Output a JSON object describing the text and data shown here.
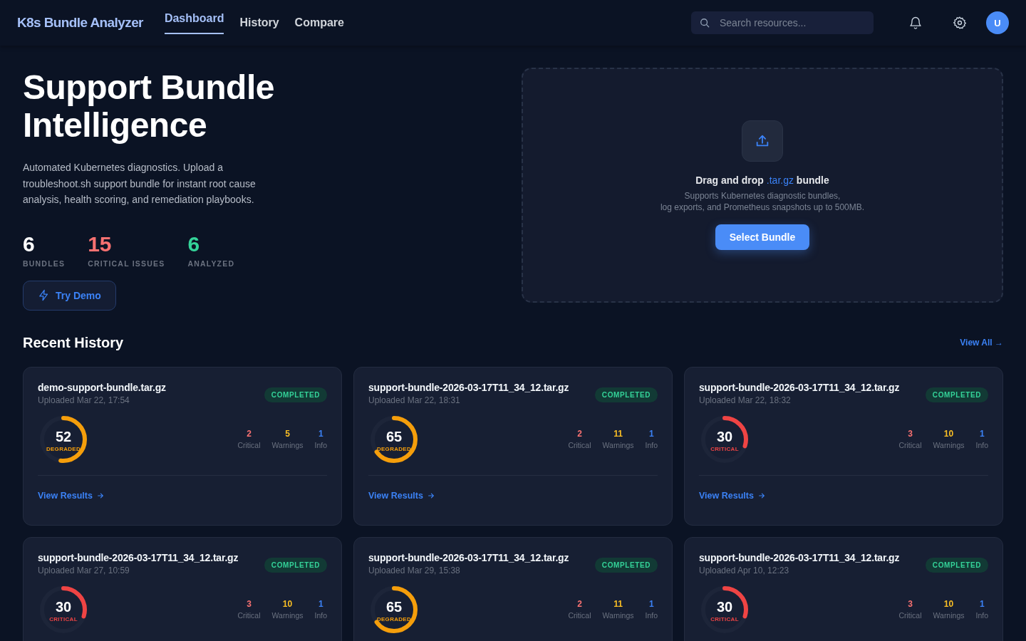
{
  "header": {
    "logo": "K8s Bundle Analyzer",
    "nav": [
      {
        "label": "Dashboard",
        "selected": true
      },
      {
        "label": "History",
        "selected": false
      },
      {
        "label": "Compare",
        "selected": false
      }
    ],
    "search": {
      "placeholder": "Search resources..."
    },
    "avatar": "U"
  },
  "hero": {
    "title": "Support Bundle Intelligence",
    "description": "Automated Kubernetes diagnostics. Upload a troubleshoot.sh support bundle for instant root cause analysis, health scoring, and remediation playbooks.",
    "stats": [
      {
        "value": "6",
        "label": "BUNDLES",
        "color": "#ffffff"
      },
      {
        "value": "15",
        "label": "CRITICAL ISSUES",
        "color": "#f87171"
      },
      {
        "value": "6",
        "label": "ANALYZED",
        "color": "#34d399"
      }
    ],
    "demo_button": "Try Demo"
  },
  "upload": {
    "heading": "Drag and drop *.tar.gz* bundle",
    "hint_lines": [
      "Supports Kubernetes diagnostic bundles,",
      "log exports, and Prometheus snapshots up to 500MB."
    ],
    "button": "Select Bundle"
  },
  "history": {
    "title": "Recent History",
    "view_all": "View All →",
    "cards": [
      {
        "name": "demo-support-bundle.tar.gz",
        "uploaded": "Uploaded Mar 22, 17:54",
        "status": "COMPLETED",
        "score": "52",
        "level": 0.52,
        "health": "DEGRADED",
        "kind": "degraded",
        "counts": [
          {
            "value": "2",
            "label": "Critical",
            "kind": "critical"
          },
          {
            "value": "5",
            "label": "Warnings",
            "kind": "warning"
          },
          {
            "value": "1",
            "label": "Info",
            "kind": "info"
          }
        ],
        "link": "View Results"
      },
      {
        "name": "support-bundle-2026-03-17T11_34_12.tar.gz",
        "uploaded": "Uploaded Mar 22, 18:31",
        "status": "COMPLETED",
        "score": "65",
        "level": 0.65,
        "health": "DEGRADED",
        "kind": "degraded",
        "counts": [
          {
            "value": "2",
            "label": "Critical",
            "kind": "critical"
          },
          {
            "value": "11",
            "label": "Warnings",
            "kind": "warning"
          },
          {
            "value": "1",
            "label": "Info",
            "kind": "info"
          }
        ],
        "link": "View Results"
      },
      {
        "name": "support-bundle-2026-03-17T11_34_12.tar.gz",
        "uploaded": "Uploaded Mar 22, 18:32",
        "status": "COMPLETED",
        "score": "30",
        "level": 0.3,
        "health": "CRITICAL",
        "kind": "critical",
        "counts": [
          {
            "value": "3",
            "label": "Critical",
            "kind": "critical"
          },
          {
            "value": "10",
            "label": "Warnings",
            "kind": "warning"
          },
          {
            "value": "1",
            "label": "Info",
            "kind": "info"
          }
        ],
        "link": "View Results"
      },
      {
        "name": "support-bundle-2026-03-17T11_34_12.tar.gz",
        "uploaded": "Uploaded Mar 27, 10:59",
        "status": "COMPLETED",
        "score": "30",
        "level": 0.3,
        "health": "CRITICAL",
        "kind": "critical",
        "counts": [
          {
            "value": "3",
            "label": "Critical",
            "kind": "critical"
          },
          {
            "value": "10",
            "label": "Warnings",
            "kind": "warning"
          },
          {
            "value": "1",
            "label": "Info",
            "kind": "info"
          }
        ]
      },
      {
        "name": "support-bundle-2026-03-17T11_34_12.tar.gz",
        "uploaded": "Uploaded Mar 29, 15:38",
        "status": "COMPLETED",
        "score": "65",
        "level": 0.65,
        "health": "DEGRADED",
        "kind": "degraded",
        "counts": [
          {
            "value": "2",
            "label": "Critical",
            "kind": "critical"
          },
          {
            "value": "11",
            "label": "Warnings",
            "kind": "warning"
          },
          {
            "value": "1",
            "label": "Info",
            "kind": "info"
          }
        ]
      },
      {
        "name": "support-bundle-2026-03-17T11_34_12.tar.gz",
        "uploaded": "Uploaded Apr 10, 12:23",
        "status": "COMPLETED",
        "score": "30",
        "level": 0.3,
        "health": "CRITICAL",
        "kind": "critical",
        "counts": [
          {
            "value": "3",
            "label": "Critical",
            "kind": "critical"
          },
          {
            "value": "10",
            "label": "Warnings",
            "kind": "warning"
          },
          {
            "value": "1",
            "label": "Info",
            "kind": "info"
          }
        ]
      }
    ]
  }
}
